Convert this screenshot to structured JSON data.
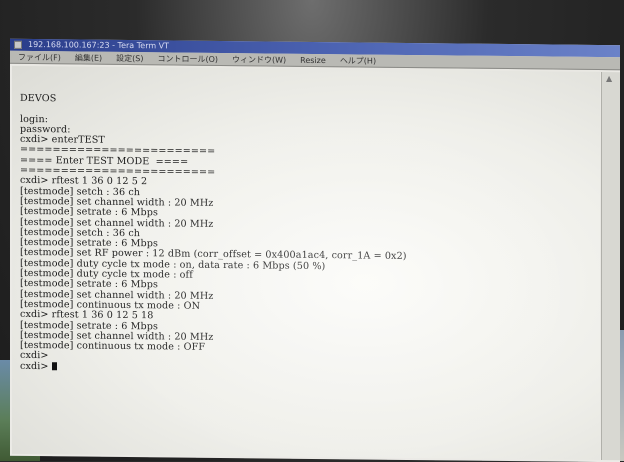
{
  "window": {
    "title": "192.168.100.167:23 - Tera Term VT"
  },
  "menu": {
    "items": [
      "ファイル(F)",
      "編集(E)",
      "設定(S)",
      "コントロール(O)",
      "ウィンドウ(W)",
      "Resize",
      "ヘルプ(H)"
    ]
  },
  "terminal": {
    "lines": [
      "DEVOS",
      "",
      "login:",
      "password:",
      "cxdi> enterTEST",
      "========================",
      "==== Enter TEST MODE  ====",
      "========================",
      "cxdi> rftest 1 36 0 12 5 2",
      "[testmode] setch : 36 ch",
      "[testmode] set channel width : 20 MHz",
      "[testmode] setrate : 6 Mbps",
      "[testmode] set channel width : 20 MHz",
      "[testmode] setch : 36 ch",
      "[testmode] setrate : 6 Mbps",
      "[testmode] set RF power : 12 dBm (corr_offset = 0x400a1ac4, corr_1A = 0x2)",
      "[testmode] duty cycle tx mode : on, data rate : 6 Mbps (50 %)",
      "[testmode] duty cycle tx mode : off",
      "[testmode] setrate : 6 Mbps",
      "[testmode] set channel width : 20 MHz",
      "[testmode] continuous tx mode : ON",
      "cxdi> rftest 1 36 0 12 5 18",
      "[testmode] setrate : 6 Mbps",
      "[testmode] set channel width : 20 MHz",
      "[testmode] continuous tx mode : OFF",
      "cxdi>",
      "cxdi>"
    ]
  }
}
